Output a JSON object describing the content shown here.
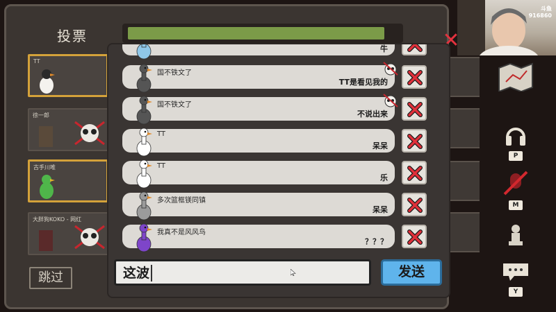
{
  "vote_screen": {
    "title": "投票",
    "timer_fraction": 0.95,
    "skip_label": "跳过",
    "players": [
      {
        "name": "TT",
        "alive": true,
        "highlighted": true
      },
      {
        "name": "徐一郎",
        "alive": false,
        "highlighted": false
      },
      {
        "name": "古手川唯",
        "alive": true,
        "highlighted": true
      },
      {
        "name": "大胖狗KOKO - 网红",
        "alive": false,
        "highlighted": false
      }
    ]
  },
  "side_controls": {
    "map_icon": "map-icon",
    "listen_key": "P",
    "mute_key": "M",
    "chat_key": "Y"
  },
  "webcam": {
    "logo_line1": "斗鱼",
    "logo_line2": "916860"
  },
  "chat": {
    "messages": [
      {
        "sender": "",
        "text": "牛",
        "avatar_color": "#8fc7e8",
        "voted": true
      },
      {
        "sender": "国不铁文了",
        "text": "TT是看见我的",
        "avatar_color": "#555555",
        "voted": true
      },
      {
        "sender": "国不铁文了",
        "text": "不说出来",
        "avatar_color": "#555555",
        "voted": true
      },
      {
        "sender": "TT",
        "text": "呆呆",
        "avatar_color": "#ffffff",
        "voted": false
      },
      {
        "sender": "TT",
        "text": "乐",
        "avatar_color": "#ffffff",
        "voted": false
      },
      {
        "sender": "多次篮框镁同镇",
        "text": "呆呆",
        "avatar_color": "#9b9b9b",
        "voted": false
      },
      {
        "sender": "我真不是风风鸟",
        "text": "？？？",
        "avatar_color": "#7e45c9",
        "voted": false
      }
    ],
    "input_value": "这波",
    "send_label": "发送"
  }
}
